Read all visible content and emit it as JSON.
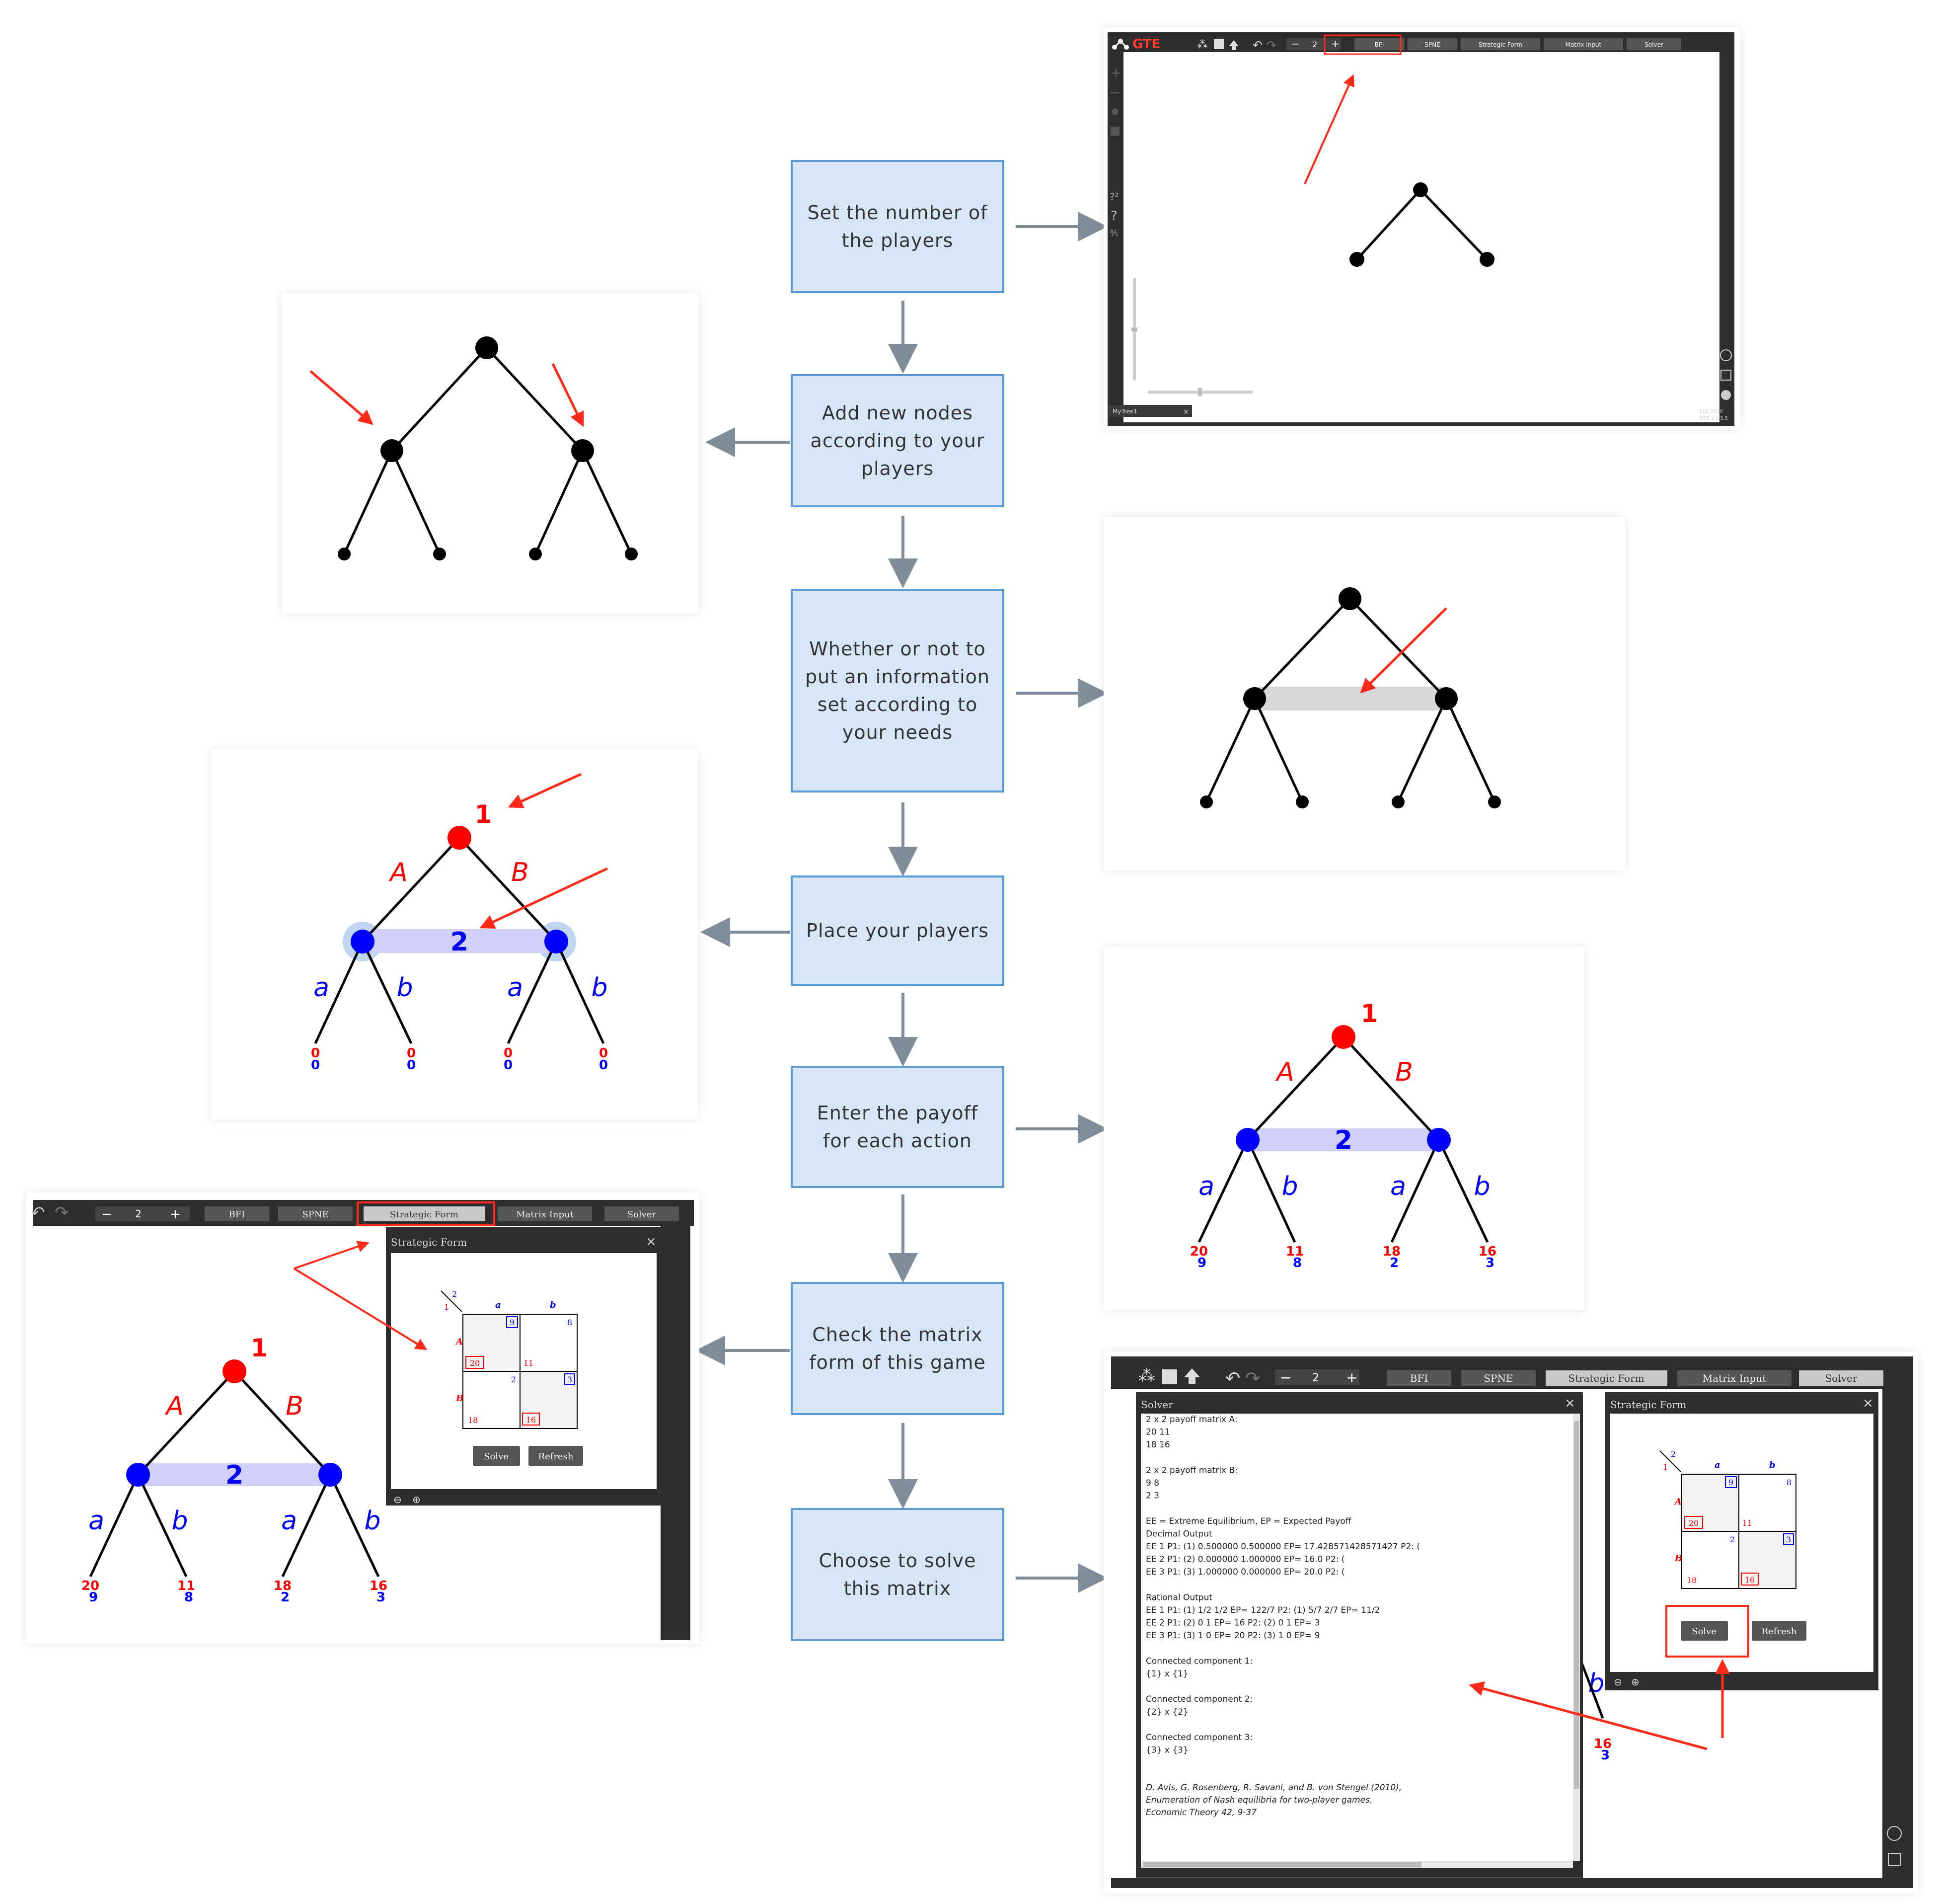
{
  "steps": [
    "Set the number of the players",
    "Add new nodes according to your players",
    "Whether or not to put an information set according to your needs",
    "Place your players",
    "Enter the payoff for each action",
    "Check the matrix form of this game",
    "Choose to solve this matrix"
  ],
  "toolbar": {
    "logo": "GTE",
    "player_count": "2",
    "minus": "−",
    "plus": "+",
    "tabs": [
      "BFI",
      "SPNE",
      "Strategic Form",
      "Matrix Input",
      "Solver"
    ],
    "tree_tab": "MyTree1",
    "footer_line1": "LSE 2020",
    "footer_line2": "GTE v.2.3.5"
  },
  "game": {
    "player1": "1",
    "player2": "2",
    "p1_actions": [
      "A",
      "B"
    ],
    "p2_actions": [
      "a",
      "b",
      "a",
      "b"
    ],
    "payoffs_zero": [
      [
        "0",
        "0"
      ],
      [
        "0",
        "0"
      ],
      [
        "0",
        "0"
      ],
      [
        "0",
        "0"
      ]
    ],
    "payoffs": [
      [
        "20",
        "9"
      ],
      [
        "11",
        "8"
      ],
      [
        "18",
        "2"
      ],
      [
        "16",
        "3"
      ]
    ]
  },
  "strategic_form": {
    "title": "Strategic Form",
    "p1_label": "1",
    "p2_label": "2",
    "row_labels": [
      "A",
      "B"
    ],
    "col_labels": [
      "a",
      "b"
    ],
    "cells": [
      {
        "p1": "20",
        "p2": "9"
      },
      {
        "p1": "11",
        "p2": "8"
      },
      {
        "p1": "18",
        "p2": "2"
      },
      {
        "p1": "16",
        "p2": "3"
      }
    ],
    "solve_label": "Solve",
    "refresh_label": "Refresh"
  },
  "solver": {
    "title": "Solver",
    "lines": [
      "2 x 2 payoff matrix A:",
      "  20  11",
      "  18  16",
      "",
      "2 x 2 payoff matrix B:",
      "   9   8",
      "   2   3",
      "",
      "EE = Extreme Equilibrium, EP = Expected Payoff",
      "Decimal Output",
      "  EE  1  P1:  (1)  0.500000  0.500000  EP=  17.428571428571427  P2:  (",
      "  EE  2  P1:  (2)  0.000000  1.000000  EP=                16.0  P2:  (",
      "  EE  3  P1:  (3)  1.000000  0.000000  EP=                20.0  P2:  (",
      "",
      "Rational Output",
      "  EE  1  P1:  (1)  1/2  1/2  EP=  122/7  P2:  (1)  5/7  2/7  EP=  11/2",
      "  EE  2  P1:  (2)    0    1  EP=     16  P2:  (2)    0    1  EP=     3",
      "  EE  3  P1:  (3)    1    0  EP=     20  P2:  (3)    1    0  EP=     9",
      "",
      "Connected component 1:",
      "{1}  x  {1}",
      "",
      "Connected component 2:",
      "{2}  x  {2}",
      "",
      "Connected component 3:",
      "{3}  x  {3}"
    ],
    "citation": [
      "D. Avis, G. Rosenberg, R. Savani, and B. von Stengel (2010),",
      "Enumeration of Nash equilibria for two-player games.",
      "Economic Theory 42, 9-37"
    ]
  },
  "colors": {
    "step_fill": "#d6e6f6",
    "step_border": "#5b9bd5",
    "arrow": "#7f8c99",
    "player1": "#ff0000",
    "player2": "#0000ff",
    "annotation": "#ff2a1a",
    "toolbar": "#2b2b2b",
    "info_set": "#d0d0f8"
  }
}
